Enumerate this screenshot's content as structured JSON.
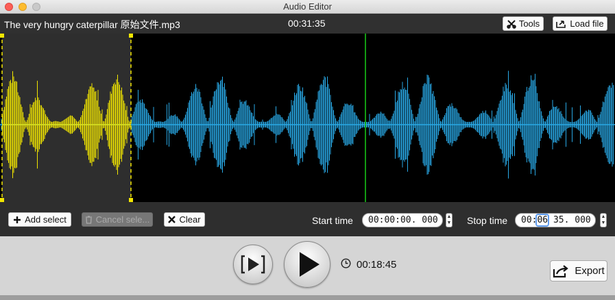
{
  "window": {
    "title": "Audio Editor"
  },
  "header": {
    "file_name": "The very hungry caterpillar 原始文件.mp3",
    "duration": "00:31:35",
    "tools_label": "Tools",
    "load_label": "Load file"
  },
  "waveform": {
    "selected_color": "#f2e600",
    "unselected_color": "#29a9e6",
    "playhead_color": "#19d019",
    "selection_fill": "#2e2e2e",
    "selection_marker_color": "#f2e600"
  },
  "controls": {
    "add_select_label": "Add select",
    "cancel_select_label": "Cancel sele...",
    "clear_label": "Clear",
    "start_time_label": "Start time",
    "start_time_value": "00:00:00. 000",
    "stop_time_label": "Stop time",
    "stop_time_hh": "00:",
    "stop_time_mm": "06",
    "stop_time_rest": " 35. 000"
  },
  "transport": {
    "elapsed": "00:18:45",
    "export_label": "Export"
  },
  "icons": {
    "tools": "scissors-icon",
    "load": "load-file-icon",
    "add": "plus-icon",
    "cancel": "trash-icon",
    "clear": "x-icon",
    "play_selection": "play-selection-icon",
    "play": "play-icon",
    "clock": "clock-icon",
    "export": "export-icon"
  }
}
